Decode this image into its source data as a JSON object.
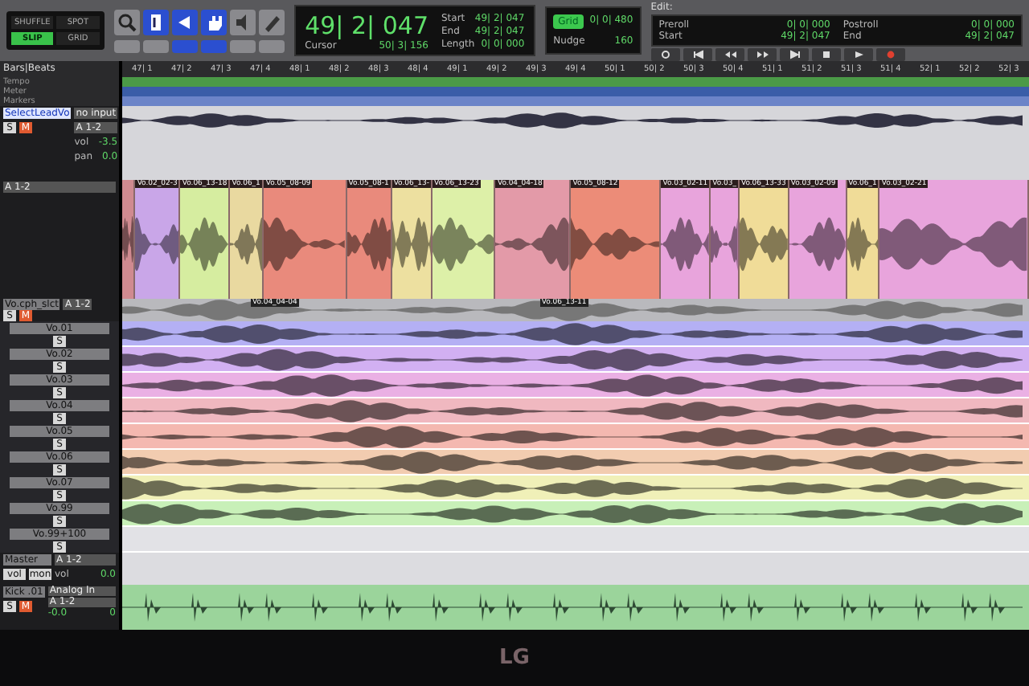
{
  "edit_modes": [
    {
      "label": "SHUFFLE",
      "selected": false
    },
    {
      "label": "SPOT",
      "selected": false
    },
    {
      "label": "SLIP",
      "selected": true
    },
    {
      "label": "GRID",
      "selected": false
    }
  ],
  "tools": [
    {
      "kind": "zoom",
      "selected": false
    },
    {
      "kind": "trim",
      "selected": true
    },
    {
      "kind": "select",
      "selected": true
    },
    {
      "kind": "grab",
      "selected": true
    },
    {
      "kind": "scrub",
      "selected": false
    },
    {
      "kind": "pencil",
      "selected": false
    }
  ],
  "counter": {
    "main": "49| 2| 047",
    "cursor_label": "Cursor",
    "cursor": "50| 3| 156",
    "fields": [
      {
        "label": "Start",
        "value": "49| 2| 047"
      },
      {
        "label": "End",
        "value": "49| 2| 047"
      },
      {
        "label": "Length",
        "value": "0| 0| 000"
      }
    ]
  },
  "grid": {
    "grid_label": "Grid",
    "grid_value": "0| 0| 480",
    "nudge_label": "Nudge",
    "nudge_value": "160"
  },
  "window_title": "Edit:",
  "transport": {
    "fields": [
      {
        "label": "Preroll",
        "value": "0| 0| 000"
      },
      {
        "label": "Postroll",
        "value": "0| 0| 000"
      },
      {
        "label": "Start",
        "value": "49| 2| 047"
      },
      {
        "label": "End",
        "value": "49| 2| 047"
      }
    ]
  },
  "ruler": {
    "names": [
      "Bars|Beats",
      "Tempo",
      "Meter",
      "Markers"
    ],
    "bars": [
      "47| 1",
      "47| 2",
      "47| 3",
      "47| 4",
      "48| 1",
      "48| 2",
      "48| 3",
      "48| 4",
      "49| 1",
      "49| 2",
      "49| 3",
      "49| 4",
      "50| 1",
      "50| 2",
      "50| 3",
      "50| 4",
      "51| 1",
      "51| 2",
      "51| 3",
      "51| 4",
      "52| 1",
      "52| 2",
      "52| 3"
    ]
  },
  "lead_track": {
    "name": "SelectLeadVo",
    "selected": true,
    "buttons": [
      "S",
      "M"
    ],
    "input": "no input",
    "output": "A 1-2",
    "vol_label": "vol",
    "vol": "-3.5",
    "pan_label": "pan",
    "pan": "0.0"
  },
  "comp_clips": [
    {
      "color": "#d08a90"
    },
    {
      "name": "Vo.02_02-3",
      "color": "#c9a6e8"
    },
    {
      "name": "Vo.06_13-18",
      "color": "#d6eda0"
    },
    {
      "name": "Vo.06_1",
      "color": "#e9d9a0"
    },
    {
      "name": "Vo.05_08-09",
      "color": "#e98a7c"
    },
    {
      "name": "Vo.05_08-1",
      "color": "#e98a7c"
    },
    {
      "name": "Vo.06_13-",
      "color": "#ede0a0"
    },
    {
      "name": "Vo.06_13-23",
      "color": "#ddf0a8"
    },
    {
      "name": "Vo.04_04-18",
      "color": "#e39aa8"
    },
    {
      "name": "Vo.05_08-12",
      "color": "#ec8c78"
    },
    {
      "name": "Vo.03_02-11",
      "color": "#e8a4dc"
    },
    {
      "name": "Vo.03_",
      "color": "#e8a4dc"
    },
    {
      "name": "Vo.06_13-33",
      "color": "#f0dc98"
    },
    {
      "name": "Vo.03_02-09",
      "color": "#e8a4dc"
    },
    {
      "name": "Vo.06_1",
      "color": "#f0dc98"
    },
    {
      "name": "Vo.03_02-21",
      "color": "#e8a4dc"
    }
  ],
  "comp_header": {
    "output": "A 1-2"
  },
  "comp_track": {
    "name": "Vo.cph_slct",
    "buttons": [
      "S",
      "M"
    ],
    "output": "A 1-2",
    "clips": [
      "Vo.04_04-04",
      "Vo.06_13-11"
    ]
  },
  "lanes": [
    {
      "name": "Vo.01",
      "solo": "S",
      "color": "#b4b0f4"
    },
    {
      "name": "Vo.02",
      "solo": "S",
      "color": "#d2b0f2"
    },
    {
      "name": "Vo.03",
      "solo": "S",
      "color": "#eab0e4"
    },
    {
      "name": "Vo.04",
      "solo": "S",
      "color": "#f0b8c0"
    },
    {
      "name": "Vo.05",
      "solo": "S",
      "color": "#f4b8b0"
    },
    {
      "name": "Vo.06",
      "solo": "S",
      "color": "#f2ccb0"
    },
    {
      "name": "Vo.07",
      "solo": "S",
      "color": "#f0f0b8"
    },
    {
      "name": "Vo.99",
      "solo": "S",
      "color": "#c8f0b8"
    },
    {
      "name": "Vo.99+100",
      "solo": "S",
      "color": "#e2e2e6"
    }
  ],
  "master": {
    "name": "Master",
    "buttons": [
      "vol",
      "mon"
    ],
    "output": "A 1-2",
    "vol_label": "vol",
    "vol": "0.0"
  },
  "kick": {
    "name": "Kick .01",
    "buttons": [
      "S",
      "M"
    ],
    "input": "Analog In",
    "output": "A 1-2",
    "vol": "-0.0",
    "pan": "0"
  },
  "bezel_logo": "LG"
}
